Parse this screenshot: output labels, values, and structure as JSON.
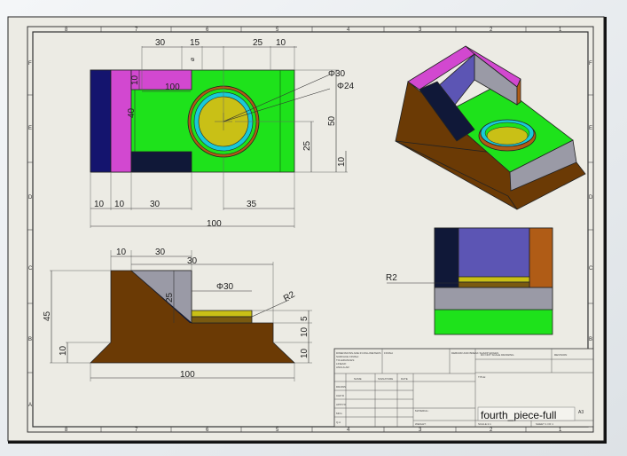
{
  "colors": {
    "desktop": "#e9ecef",
    "sheet": "#ecebe4",
    "green": "#1ee21b",
    "magenta": "#d248d0",
    "navy": "#14146e",
    "dark_navy": "#101838",
    "brown": "#6b3a05",
    "yellow": "#c9c016",
    "cyan": "#19c9d8",
    "orange_brown": "#b05c16",
    "grey": "#9a9aa6",
    "purple_blue": "#5c55b4"
  },
  "sheet": {
    "columns_top": [
      "8",
      "7",
      "6",
      "5",
      "4",
      "3",
      "2",
      "1"
    ],
    "columns_bottom": [
      "8",
      "7",
      "6",
      "5",
      "4",
      "3",
      "2",
      "1"
    ],
    "rows_left": [
      "F",
      "E",
      "D",
      "C",
      "B",
      "A"
    ],
    "rows_right": [
      "F",
      "E",
      "D",
      "C",
      "B",
      "A"
    ]
  },
  "top_view": {
    "dims": {
      "d30": "30",
      "d15": "15",
      "d25": "25",
      "d10": "10",
      "phi30": "Φ30",
      "phi24": "Φ24",
      "d10v": "10",
      "d100": "100",
      "d40": "40",
      "d50": "50",
      "d25v": "25",
      "d10r": "10",
      "b10a": "10",
      "b10b": "10",
      "b30": "30",
      "b35": "35",
      "b100": "100"
    }
  },
  "front_view": {
    "dims": {
      "t10": "10",
      "t30": "30",
      "t30b": "30",
      "phi30": "Φ30",
      "r2": "R2",
      "v45": "45",
      "v25": "25",
      "v10": "10",
      "v10b": "10",
      "v5": "5",
      "v10c": "10",
      "b100": "100"
    }
  },
  "side_view": {
    "dims": {
      "r2": "R2"
    }
  },
  "title_block": {
    "part_name": "fourth_piece-full",
    "sheet_size": "A3",
    "notes": [
      "DIMENSIONS ARE IN MILLIMETERS",
      "SURFACE FINISH:",
      "TOLERANCES:",
      "LINEAR:",
      "ANGULAR:"
    ],
    "finish": "FINISH",
    "deburr": "DEBURR AND BREAK SHARP EDGES",
    "do_not_scale": "DO NOT SCALE DRAWING",
    "revision": "REVISION",
    "headers": [
      "NAME",
      "SIGNATURE",
      "DATE"
    ],
    "rows": [
      "DRAWN",
      "CHK'D",
      "APPV'D",
      "MFG",
      "Q.A"
    ],
    "title_label": "TITLE:",
    "material": "MATERIAL:",
    "weight": "WEIGHT:",
    "dwg_no": "DWG NO.",
    "scale": "SCALE:1:1",
    "sheet_of": "SHEET 1 OF 1"
  }
}
